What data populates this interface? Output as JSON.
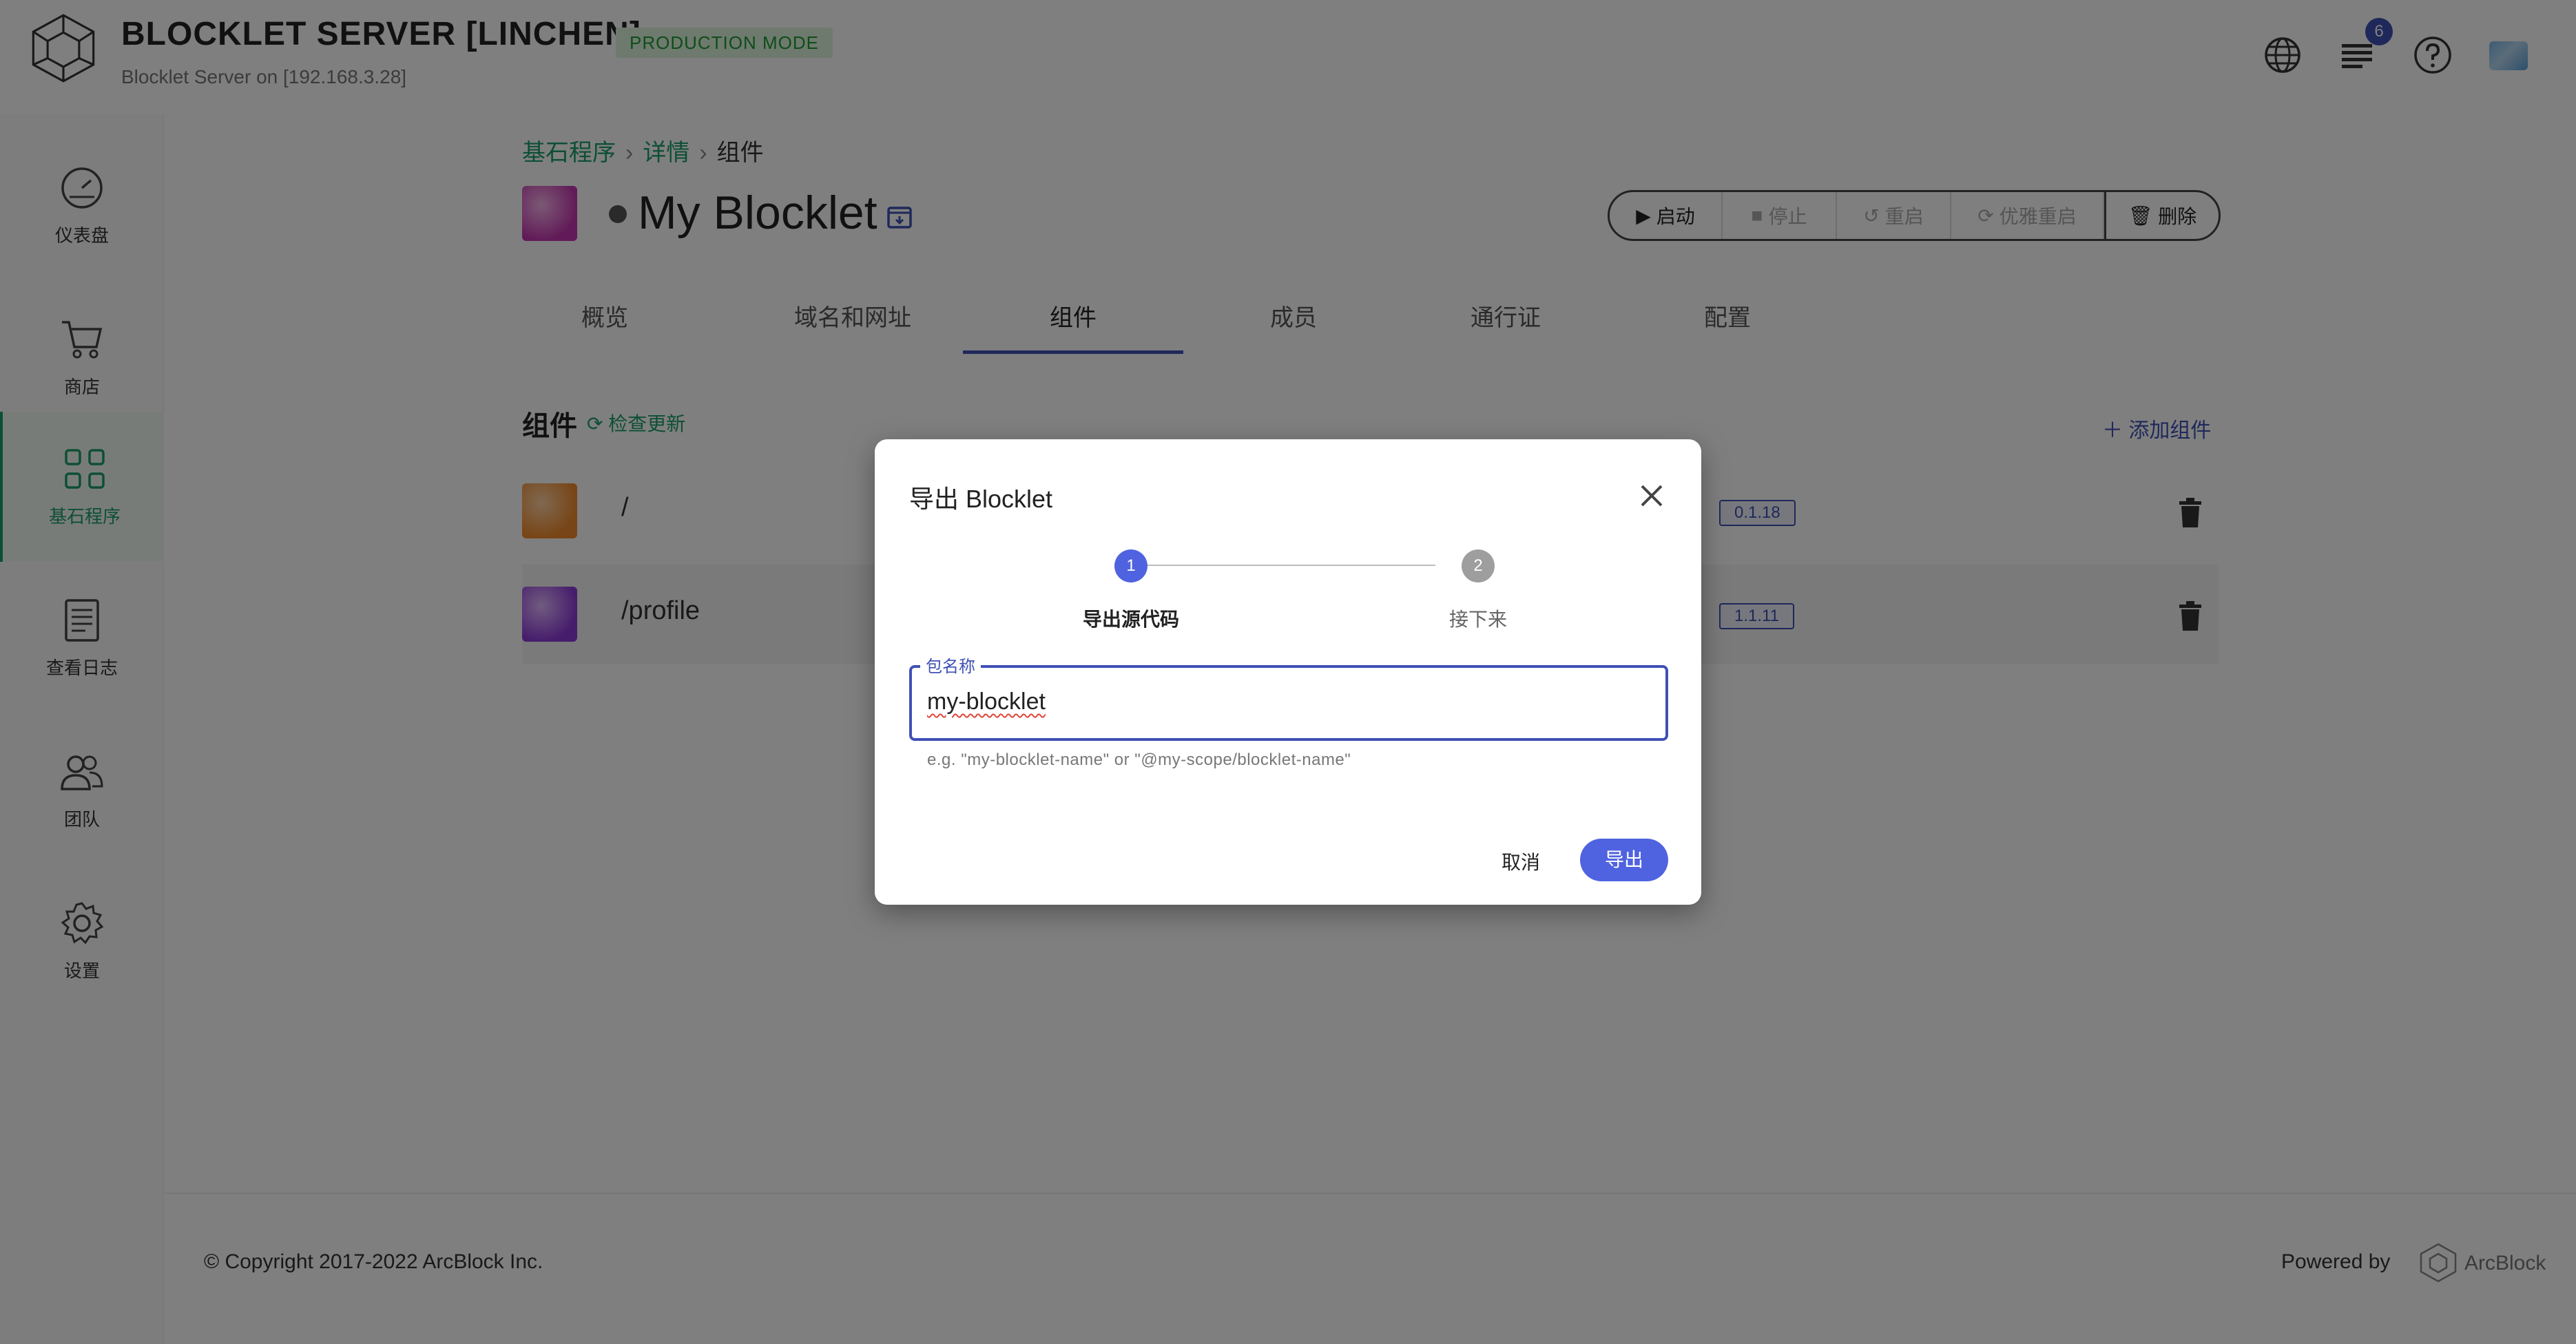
{
  "header": {
    "title": "BLOCKLET SERVER [LINCHEN]",
    "mode_badge": "PRODUCTION MODE",
    "subtitle": "Blocklet Server on [192.168.3.28]",
    "notification_count": "6",
    "icons": [
      "globe-icon",
      "notifications-icon",
      "help-icon",
      "user-avatar"
    ]
  },
  "sidebar": {
    "items": [
      {
        "label": "仪表盘",
        "icon": "dashboard-icon"
      },
      {
        "label": "商店",
        "icon": "cart-icon"
      },
      {
        "label": "基石程序",
        "icon": "apps-grid-icon",
        "active": true
      },
      {
        "label": "查看日志",
        "icon": "logs-icon"
      },
      {
        "label": "团队",
        "icon": "team-icon"
      },
      {
        "label": "设置",
        "icon": "settings-icon"
      }
    ]
  },
  "breadcrumb": {
    "items": [
      "基石程序",
      "详情",
      "组件"
    ],
    "separator": "›"
  },
  "blocklet": {
    "title": "My Blocklet",
    "actions": [
      {
        "label": "启动",
        "icon": "play-icon",
        "enabled": true
      },
      {
        "label": "停止",
        "icon": "stop-icon",
        "enabled": false
      },
      {
        "label": "重启",
        "icon": "restart-icon",
        "enabled": false
      },
      {
        "label": "优雅重启",
        "icon": "reload-icon",
        "enabled": false
      },
      {
        "label": "删除",
        "icon": "trash-icon",
        "enabled": true
      }
    ]
  },
  "tabs": [
    {
      "label": "概览"
    },
    {
      "label": "域名和网址"
    },
    {
      "label": "组件",
      "active": true
    },
    {
      "label": "成员"
    },
    {
      "label": "通行证"
    },
    {
      "label": "配置"
    }
  ],
  "components": {
    "title": "组件",
    "check_update": "检查更新",
    "add_label": "添加组件",
    "rows": [
      {
        "path": "/",
        "version": "0.1.18",
        "logo_color": "#f39a3d"
      },
      {
        "path": "/profile",
        "version": "1.1.11",
        "logo_color": "#a255e6"
      }
    ]
  },
  "footer": {
    "copyright": "© Copyright 2017-2022  ArcBlock Inc.",
    "powered_by": "Powered by",
    "brand": "ArcBlock"
  },
  "dialog": {
    "title": "导出 Blocklet",
    "steps": [
      {
        "number": "1",
        "label": "导出源代码",
        "active": true
      },
      {
        "number": "2",
        "label": "接下来",
        "active": false
      }
    ],
    "field": {
      "label": "包名称",
      "value": "my-blocklet",
      "helper": "e.g. \"my-blocklet-name\" or \"@my-scope/blocklet-name\""
    },
    "cancel_label": "取消",
    "export_label": "导出"
  },
  "colors": {
    "accent": "#3f51b5",
    "brand_green": "#1b9e6b",
    "export_button": "#4f63e0",
    "overlay": "rgba(0,0,0,0.5)"
  }
}
